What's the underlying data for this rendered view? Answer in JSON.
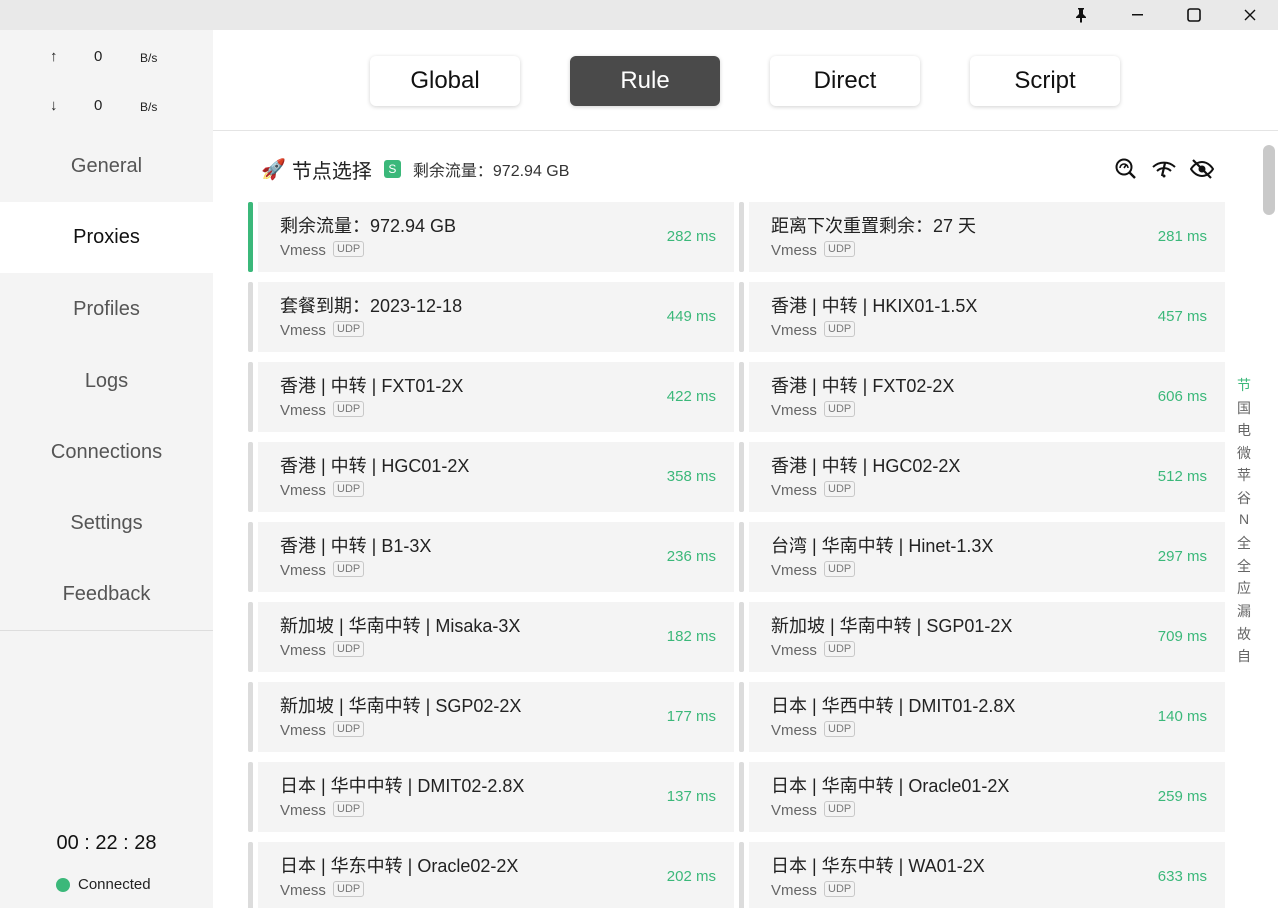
{
  "titlebar": {
    "pin_icon": "pin-icon",
    "minimize": "—",
    "maximize": "☐",
    "close": "✕"
  },
  "traffic": {
    "up": {
      "arrow": "↑",
      "value": "0",
      "unit": "B/s"
    },
    "down": {
      "arrow": "↓",
      "value": "0",
      "unit": "B/s"
    }
  },
  "nav": {
    "items": [
      {
        "label": "General"
      },
      {
        "label": "Proxies"
      },
      {
        "label": "Profiles"
      },
      {
        "label": "Logs"
      },
      {
        "label": "Connections"
      },
      {
        "label": "Settings"
      },
      {
        "label": "Feedback"
      }
    ],
    "active": "Proxies"
  },
  "timer": "00 : 22 : 28",
  "status": {
    "label": "Connected",
    "color": "#3bb87a"
  },
  "modes": [
    {
      "label": "Global"
    },
    {
      "label": "Rule"
    },
    {
      "label": "Direct"
    },
    {
      "label": "Script"
    }
  ],
  "active_mode": "Rule",
  "group": {
    "emoji": "🚀",
    "name": "节点选择",
    "badge": "S",
    "note": "剩余流量：972.94 GB",
    "icons": [
      "search-latency-icon",
      "wifi-speed-icon",
      "eye-off-icon"
    ]
  },
  "proxies": [
    {
      "name": "剩余流量：972.94 GB",
      "type": "Vmess",
      "udp": "UDP",
      "delay": "282 ms",
      "selected": true
    },
    {
      "name": "距离下次重置剩余：27 天",
      "type": "Vmess",
      "udp": "UDP",
      "delay": "281 ms"
    },
    {
      "name": "套餐到期：2023-12-18",
      "type": "Vmess",
      "udp": "UDP",
      "delay": "449 ms"
    },
    {
      "name": "香港 | 中转 | HKIX01-1.5X",
      "type": "Vmess",
      "udp": "UDP",
      "delay": "457 ms"
    },
    {
      "name": "香港 | 中转 | FXT01-2X",
      "type": "Vmess",
      "udp": "UDP",
      "delay": "422 ms"
    },
    {
      "name": "香港 | 中转 | FXT02-2X",
      "type": "Vmess",
      "udp": "UDP",
      "delay": "606 ms"
    },
    {
      "name": "香港 | 中转 | HGC01-2X",
      "type": "Vmess",
      "udp": "UDP",
      "delay": "358 ms"
    },
    {
      "name": "香港 | 中转 | HGC02-2X",
      "type": "Vmess",
      "udp": "UDP",
      "delay": "512 ms"
    },
    {
      "name": "香港 | 中转 | B1-3X",
      "type": "Vmess",
      "udp": "UDP",
      "delay": "236 ms"
    },
    {
      "name": "台湾 | 华南中转 | Hinet-1.3X",
      "type": "Vmess",
      "udp": "UDP",
      "delay": "297 ms"
    },
    {
      "name": "新加坡 | 华南中转 | Misaka-3X",
      "type": "Vmess",
      "udp": "UDP",
      "delay": "182 ms"
    },
    {
      "name": "新加坡 | 华南中转 | SGP01-2X",
      "type": "Vmess",
      "udp": "UDP",
      "delay": "709 ms"
    },
    {
      "name": "新加坡 | 华南中转 | SGP02-2X",
      "type": "Vmess",
      "udp": "UDP",
      "delay": "177 ms"
    },
    {
      "name": "日本 | 华西中转 | DMIT01-2.8X",
      "type": "Vmess",
      "udp": "UDP",
      "delay": "140 ms"
    },
    {
      "name": "日本 | 华中中转 | DMIT02-2.8X",
      "type": "Vmess",
      "udp": "UDP",
      "delay": "137 ms"
    },
    {
      "name": "日本 | 华南中转 | Oracle01-2X",
      "type": "Vmess",
      "udp": "UDP",
      "delay": "259 ms"
    },
    {
      "name": "日本 | 华东中转 | Oracle02-2X",
      "type": "Vmess",
      "udp": "UDP",
      "delay": "202 ms"
    },
    {
      "name": "日本 | 华东中转 | WA01-2X",
      "type": "Vmess",
      "udp": "UDP",
      "delay": "633 ms"
    }
  ],
  "group_index": [
    "节",
    "国",
    "电",
    "微",
    "苹",
    "谷",
    "N",
    "全",
    "全",
    "应",
    "漏",
    "故",
    "自"
  ],
  "accent_color": "#3bb87a"
}
